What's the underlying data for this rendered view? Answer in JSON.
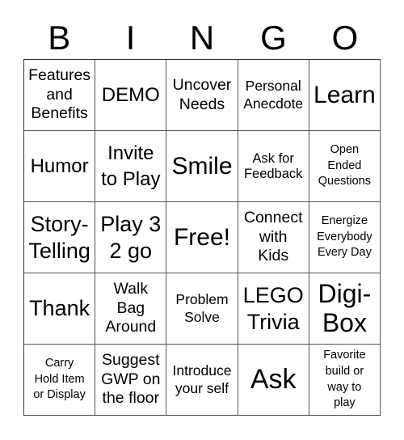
{
  "header": [
    "B",
    "I",
    "N",
    "G",
    "O"
  ],
  "cells": [
    "Features\nand\nBenefits",
    "DEMO",
    "Uncover\nNeeds",
    "Personal\nAnecdote",
    "Learn",
    "Humor",
    "Invite\nto Play",
    "Smile",
    "Ask for\nFeedback",
    "Open\nEnded\nQuestions",
    "Story-\nTelling",
    "Play 3\n2 go",
    "Free!",
    "Connect\nwith\nKids",
    "Energize\nEverybody\nEvery Day",
    "Thank",
    "Walk\nBag\nAround",
    "Problem\nSolve",
    "LEGO\nTrivia",
    "Digi-\nBox",
    "Carry\nHold Item\nor Display",
    "Suggest\nGWP on\nthe floor",
    "Introduce\nyour self",
    "Ask",
    "Favorite\nbuild or\nway to\nplay"
  ]
}
